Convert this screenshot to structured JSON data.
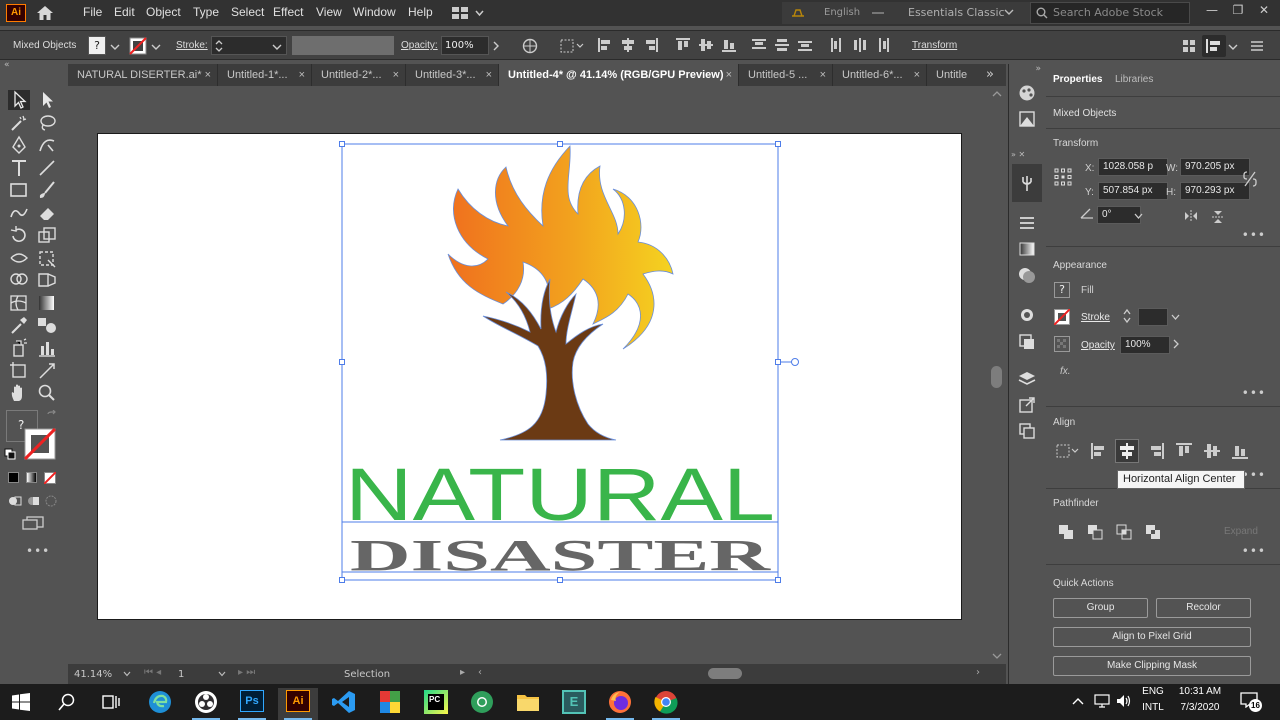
{
  "app": {
    "logo_text": "Ai",
    "menu": [
      "File",
      "Edit",
      "Object",
      "Type",
      "Select",
      "Effect",
      "View",
      "Window",
      "Help"
    ],
    "language": "English",
    "workspace": "Essentials Classic",
    "search_placeholder": "Search Adobe Stock",
    "accent_color": "#ff9a00"
  },
  "control_bar": {
    "selection_label": "Mixed Objects",
    "fill_value": "?",
    "stroke_label": "Stroke:",
    "opacity_label": "Opacity:",
    "opacity_value": "100%",
    "transform_label": "Transform"
  },
  "tabs": [
    {
      "label": "NATURAL DISERTER.ai*",
      "close": "×"
    },
    {
      "label": "Untitled-1*...",
      "close": "×"
    },
    {
      "label": "Untitled-2*...",
      "close": "×"
    },
    {
      "label": "Untitled-3*...",
      "close": "×"
    },
    {
      "label": "Untitled-4* @ 41.14% (RGB/GPU Preview)",
      "close": "×"
    },
    {
      "label": "Untitled-5 ...",
      "close": "×"
    },
    {
      "label": "Untitled-6*...",
      "close": "×"
    },
    {
      "label": "Untitle",
      "close": ""
    }
  ],
  "artwork": {
    "line1": "NATURAL",
    "line2": "DISASTER",
    "line1_color": "#39b54a",
    "line2_color": "#666666",
    "trunk_color": "#6b3a14",
    "flame_color_start": "#f0701e",
    "flame_color_end": "#f5d320"
  },
  "status_bar": {
    "zoom": "41.14%",
    "artboard_num": "1",
    "tool": "Selection"
  },
  "properties": {
    "tab_properties": "Properties",
    "tab_libraries": "Libraries",
    "selection_type": "Mixed Objects",
    "transform_title": "Transform",
    "x_label": "X:",
    "x_value": "1028.058 p",
    "w_label": "W:",
    "w_value": "970.205 px",
    "y_label": "Y:",
    "y_value": "507.854 px",
    "h_label": "H:",
    "h_value": "970.293 px",
    "angle_value": "0°",
    "appearance_title": "Appearance",
    "fill_label": "Fill",
    "stroke_label": "Stroke",
    "opacity_label": "Opacity",
    "opacity_value": "100%",
    "fx_label": "fx.",
    "align_title": "Align",
    "tooltip": "Horizontal Align Center",
    "pathfinder_title": "Pathfinder",
    "expand_label": "Expand",
    "quick_actions_title": "Quick Actions",
    "btn_group": "Group",
    "btn_recolor": "Recolor",
    "btn_align_pixel": "Align to Pixel Grid",
    "btn_clipping": "Make Clipping Mask",
    "more": "•••"
  },
  "taskbar": {
    "lang_top": "ENG",
    "lang_bottom": "INTL",
    "time": "10:31 AM",
    "date": "7/3/2020",
    "notif_count": "16",
    "icons": [
      "start-icon",
      "search-icon",
      "task-view-icon",
      "edge-icon",
      "obs-icon",
      "photoshop-icon",
      "illustrator-icon",
      "vscode-icon",
      "winrar-icon",
      "pycharm-icon",
      "chrome-green-icon",
      "file-explorer-icon",
      "vscode-insiders-icon",
      "firefox-icon",
      "chrome-icon"
    ]
  }
}
